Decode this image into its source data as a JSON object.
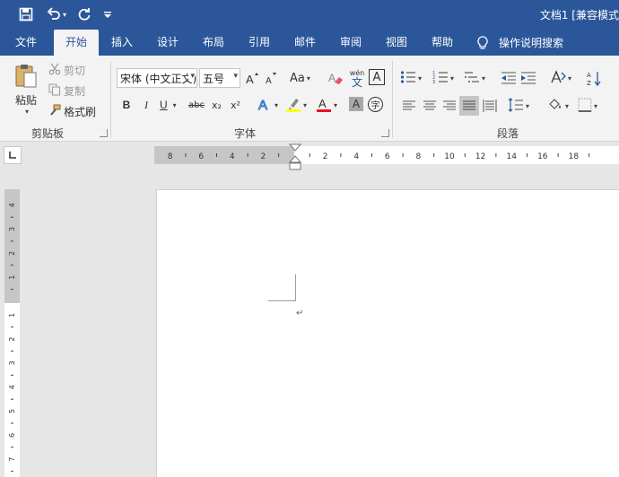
{
  "titlebar": {
    "doc_title": "文档1 [兼容模式"
  },
  "tabs": [
    {
      "label": "文件"
    },
    {
      "label": "开始"
    },
    {
      "label": "插入"
    },
    {
      "label": "设计"
    },
    {
      "label": "布局"
    },
    {
      "label": "引用"
    },
    {
      "label": "邮件"
    },
    {
      "label": "审阅"
    },
    {
      "label": "视图"
    },
    {
      "label": "帮助"
    }
  ],
  "tell_me": {
    "label": "操作说明搜索",
    "icon": "lightbulb-icon"
  },
  "clipboard": {
    "paste_label": "粘贴",
    "cut_label": "剪切",
    "copy_label": "复制",
    "format_painter_label": "格式刷",
    "group_label": "剪贴板"
  },
  "font": {
    "font_name": "宋体 (中文正文)",
    "font_size": "五号",
    "case_label": "Aa",
    "pinyin_top": "wén",
    "pinyin_bottom": "文",
    "border_char": "A",
    "bold": "B",
    "italic": "I",
    "underline": "U",
    "strike": "abc",
    "subscript": "x₂",
    "superscript": "x²",
    "shade_char": "A",
    "circle_char": "字",
    "group_label": "字体"
  },
  "paragraph": {
    "group_label": "段落"
  },
  "rulers": {
    "horizontal_left_labels": [
      "8",
      "6",
      "4",
      "2"
    ],
    "horizontal_right_labels": [
      "2",
      "4",
      "6",
      "8",
      "10",
      "12",
      "14",
      "16",
      "18"
    ],
    "vertical_top_labels": [
      "4",
      "3",
      "2",
      "1"
    ],
    "vertical_bottom_labels": [
      "1",
      "2",
      "3",
      "4",
      "5",
      "6",
      "7",
      "8"
    ]
  },
  "document": {
    "paragraph_mark": "↵"
  },
  "colors": {
    "brand": "#2b579a",
    "highlight": "#ffff00",
    "font_color": "#e81123"
  }
}
